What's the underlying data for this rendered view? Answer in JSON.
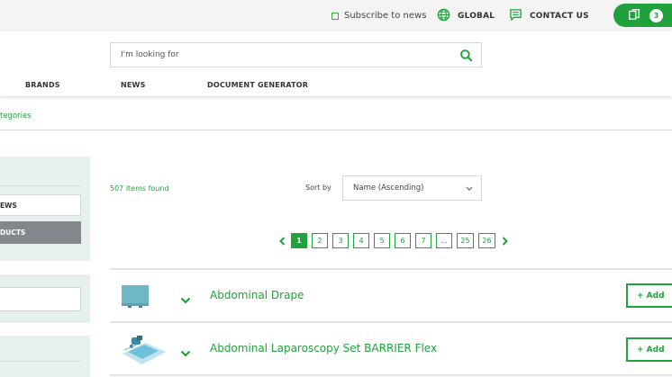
{
  "topbar": {
    "subscribe_label": "Subscribe to news",
    "global_label": "GLOBAL",
    "contact_label": "CONTACT US",
    "cart_count": "3"
  },
  "header": {
    "search_placeholder": "I'm looking for",
    "nav": [
      "BRANDS",
      "NEWS",
      "DOCUMENT GENERATOR"
    ]
  },
  "breadcrumb": "tegories",
  "filters": {
    "option_news": "EWS",
    "option_products": "DUCTS"
  },
  "results": {
    "found_text": "507 items found",
    "sort_label": "Sort by",
    "sort_value": "Name (Ascending)"
  },
  "pagination": {
    "pages": [
      "1",
      "2",
      "3",
      "4",
      "5",
      "6",
      "7",
      "...",
      "25",
      "26"
    ],
    "active": "1"
  },
  "products": [
    {
      "name": "Abdominal Drape",
      "add_label": "+ Add"
    },
    {
      "name": "Abdominal Laparoscopy Set BARRIER Flex",
      "add_label": "+ Add"
    }
  ],
  "colors": {
    "accent": "#1fa23b",
    "panel_bg": "#e6f1ef",
    "selected_filter": "#85878e"
  }
}
